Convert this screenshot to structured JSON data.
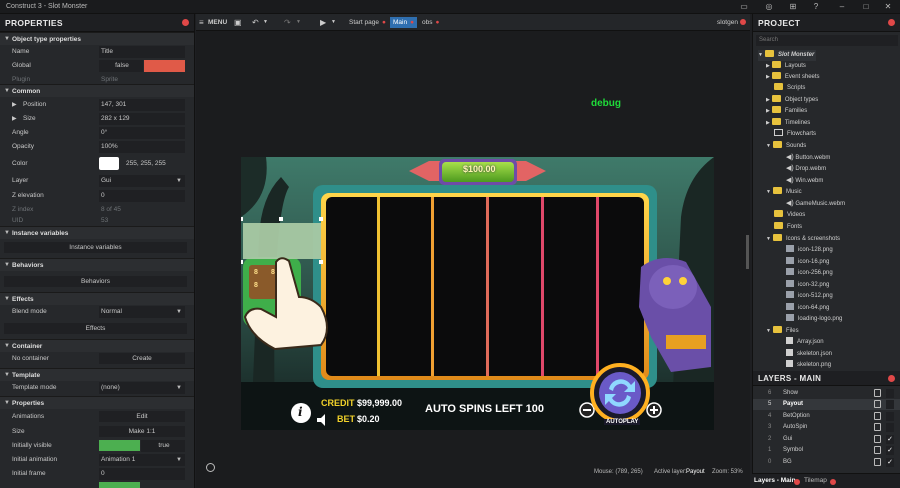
{
  "window": {
    "title": "Construct 3 - Slot Monster"
  },
  "properties": {
    "title": "PROPERTIES",
    "rows": {
      "object_type_properties": "Object type properties",
      "name_label": "Name",
      "name_value": "Title",
      "global_label": "Global",
      "global_value": "false",
      "plugin_label": "Plugin",
      "plugin_value": "Sprite",
      "common": "Common",
      "position_label": "Position",
      "position_value": "147, 301",
      "size_label": "Size",
      "size_value": "282 x 129",
      "angle_label": "Angle",
      "angle_value": "0°",
      "opacity_label": "Opacity",
      "opacity_value": "100%",
      "color_label": "Color",
      "color_value": "255, 255, 255",
      "layer_label": "Layer",
      "layer_value": "Gui",
      "zelev_label": "Z elevation",
      "zelev_value": "0",
      "zindex_label": "Z index",
      "zindex_value": "8 of 45",
      "uid_label": "UID",
      "uid_value": "53",
      "instance_variables": "Instance variables",
      "instance_variables_btn": "Instance variables",
      "behaviors": "Behaviors",
      "behaviors_btn": "Behaviors",
      "effects": "Effects",
      "blend_label": "Blend mode",
      "blend_value": "Normal",
      "effects_btn": "Effects",
      "container": "Container",
      "no_container_label": "No container",
      "create_btn": "Create",
      "template": "Template",
      "template_mode_label": "Template mode",
      "template_mode_value": "(none)",
      "properties_sect": "Properties",
      "animations_label": "Animations",
      "edit_btn": "Edit",
      "size2_label": "Size",
      "make11_btn": "Make 1:1",
      "initially_visible_label": "Initially visible",
      "initially_visible_value": "true",
      "initial_animation_label": "Initial animation",
      "initial_animation_value": "Animation 1",
      "initial_frame_label": "Initial frame",
      "initial_frame_value": "0"
    }
  },
  "toolbar": {
    "menu": "MENU",
    "tabs": [
      {
        "label": "Start page"
      },
      {
        "label": "Main"
      },
      {
        "label": "obs"
      }
    ],
    "user": "slotgen"
  },
  "stage": {
    "debug_text": "debug",
    "price": "$100.00",
    "credit_label": "CREDIT",
    "credit_value": "$99,999.00",
    "bet_label": "BET",
    "bet_value": "$0.20",
    "auto_spins": "AUTO SPINS LEFT 100",
    "autoplay": "AUTOPLAY",
    "reel_digit": "8",
    "info_glyph": "i"
  },
  "statusbar": {
    "mouse": "Mouse: (789, 265)",
    "active_layer": "Active layer:",
    "active_layer_value": "Payout",
    "zoom": "Zoom: 53%"
  },
  "project": {
    "title": "PROJECT",
    "search_placeholder": "Search",
    "root": "Slot Monster",
    "items": {
      "layouts": "Layouts",
      "event_sheets": "Event sheets",
      "scripts": "Scripts",
      "object_types": "Object types",
      "families": "Families",
      "timelines": "Timelines",
      "flowcharts": "Flowcharts",
      "sounds": "Sounds",
      "button_webm": "Button.webm",
      "drop_webm": "Drop.webm",
      "win_webm": "Win.webm",
      "music": "Music",
      "gamemusic_webm": "GameMusic.webm",
      "videos": "Videos",
      "fonts": "Fonts",
      "icons": "Icons & screenshots",
      "icon128": "icon-128.png",
      "icon16": "icon-16.png",
      "icon256": "icon-256.png",
      "icon32": "icon-32.png",
      "icon512": "icon-512.png",
      "icon64": "icon-64.png",
      "loading_logo": "loading-logo.png",
      "files": "Files",
      "array_json": "Array.json",
      "skeleton_json": "skeleton.json",
      "skeleton_png": "skeleton.png"
    }
  },
  "layers": {
    "title": "LAYERS - MAIN",
    "rows": [
      {
        "num": "6",
        "name": "Show"
      },
      {
        "num": "5",
        "name": "Payout"
      },
      {
        "num": "4",
        "name": "BetOption"
      },
      {
        "num": "3",
        "name": "AutoSpin"
      },
      {
        "num": "2",
        "name": "Gui"
      },
      {
        "num": "1",
        "name": "Symbol"
      },
      {
        "num": "0",
        "name": "BG"
      }
    ],
    "check_glyph": "✓"
  },
  "bottomtabs": {
    "layers": "Layers - Main",
    "tilemap": "Tilemap"
  },
  "colors": {
    "accent": "#2f6fb0",
    "close_dot": "#e04848",
    "debug_green": "#1fdc3a",
    "reel_frame": "#f4b82a",
    "credit_yellow": "#f2d22a"
  }
}
